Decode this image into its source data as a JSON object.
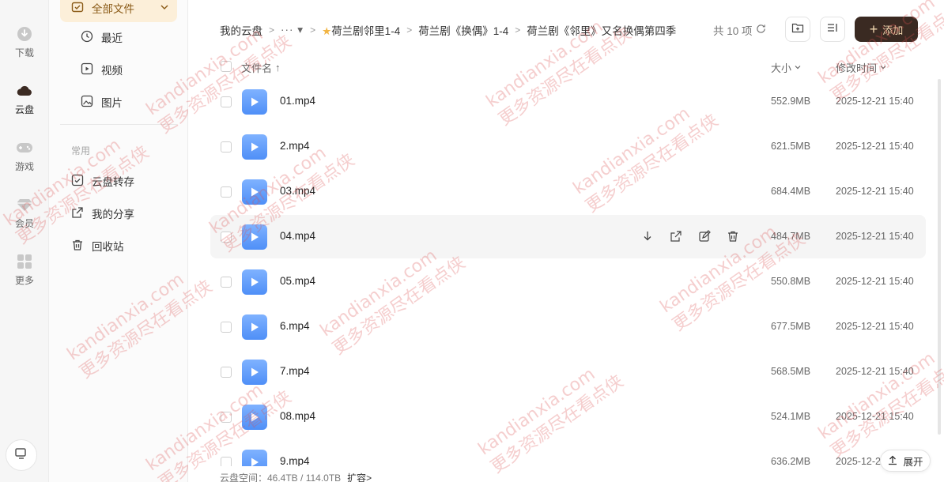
{
  "rail": {
    "items": [
      {
        "label": "下载",
        "icon": "download-icon"
      },
      {
        "label": "云盘",
        "icon": "cloud-icon"
      },
      {
        "label": "游戏",
        "icon": "gamepad-icon"
      },
      {
        "label": "会员",
        "icon": "diamond-icon"
      },
      {
        "label": "更多",
        "icon": "grid-icon"
      }
    ],
    "active": "云盘"
  },
  "sidebar": {
    "all_files": "全部文件",
    "items": [
      {
        "label": "最近",
        "icon": "clock-icon"
      },
      {
        "label": "视频",
        "icon": "play-icon"
      },
      {
        "label": "图片",
        "icon": "image-icon"
      }
    ],
    "section_title": "常用",
    "common": [
      {
        "label": "云盘转存",
        "icon": "transfer-icon"
      },
      {
        "label": "我的分享",
        "icon": "share-icon"
      },
      {
        "label": "回收站",
        "icon": "trash-icon"
      }
    ]
  },
  "breadcrumb": {
    "root": "我的云盘",
    "more": "···",
    "items": [
      "荷兰剧邻里1-4",
      "荷兰剧《换偶》1-4",
      "荷兰剧《邻里》又名换偶第四季"
    ]
  },
  "header": {
    "count": "共 10 项",
    "add_label": "添加"
  },
  "table": {
    "col_name": "文件名",
    "col_size": "大小",
    "col_date": "修改时间",
    "rows": [
      {
        "name": "01.mp4",
        "size": "552.9MB",
        "date": "2025-12-21 15:40"
      },
      {
        "name": "2.mp4",
        "size": "621.5MB",
        "date": "2025-12-21 15:40"
      },
      {
        "name": "03.mp4",
        "size": "684.4MB",
        "date": "2025-12-21 15:40"
      },
      {
        "name": "04.mp4",
        "size": "484.7MB",
        "date": "2025-12-21 15:40"
      },
      {
        "name": "05.mp4",
        "size": "550.8MB",
        "date": "2025-12-21 15:40"
      },
      {
        "name": "6.mp4",
        "size": "677.5MB",
        "date": "2025-12-21 15:40"
      },
      {
        "name": "7.mp4",
        "size": "568.5MB",
        "date": "2025-12-21 15:40"
      },
      {
        "name": "08.mp4",
        "size": "524.1MB",
        "date": "2025-12-21 15:40"
      },
      {
        "name": "9.mp4",
        "size": "636.2MB",
        "date": "2025-12-21 15:40"
      }
    ]
  },
  "footer": {
    "storage": "云盘空间：46.4TB / 114.0TB",
    "expand_link": "扩容>"
  },
  "expand_button": "展开",
  "watermark": {
    "line1": "kandianxia.com",
    "line2": "更多资源尽在看点侠"
  }
}
